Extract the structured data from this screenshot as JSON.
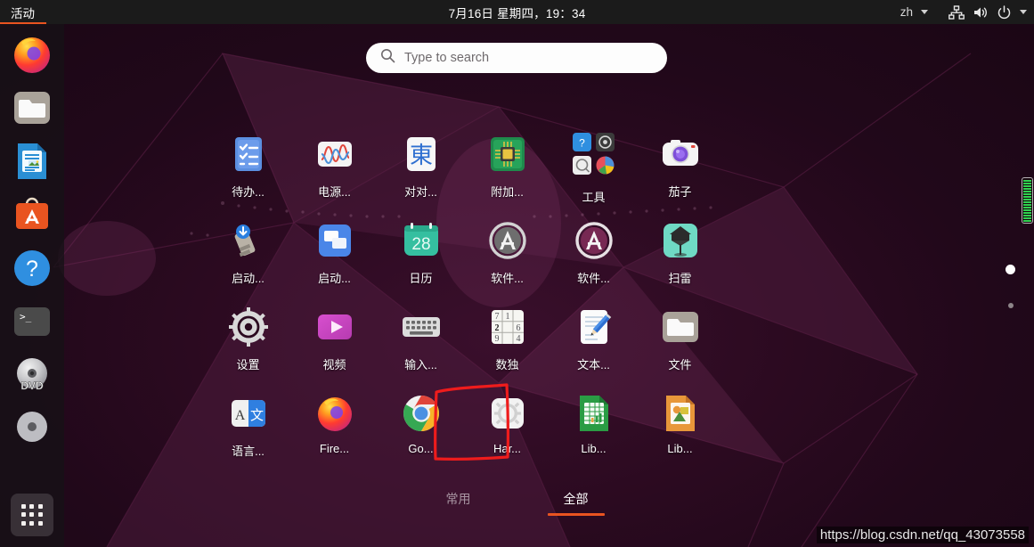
{
  "topbar": {
    "activities_label": "活动",
    "clock": "7月16日 星期四，19：34",
    "language_indicator": "zh",
    "icons": [
      "network-icon",
      "volume-icon",
      "power-icon",
      "chevron-down-icon"
    ]
  },
  "search": {
    "placeholder": "Type to search",
    "value": "",
    "icon": "search-icon"
  },
  "dock": {
    "items": [
      {
        "name": "firefox",
        "label": "Firefox"
      },
      {
        "name": "files",
        "label": "文件"
      },
      {
        "name": "libreoffice-writer",
        "label": "LibreOffice Writer"
      },
      {
        "name": "ubuntu-software",
        "label": "Ubuntu Software"
      },
      {
        "name": "help",
        "label": "帮助"
      },
      {
        "name": "terminal",
        "label": "终端"
      },
      {
        "name": "dvd-drive",
        "label": "DVD"
      },
      {
        "name": "disc-drive",
        "label": "光盘"
      }
    ],
    "show_apps_label": "显示应用程序"
  },
  "apps": [
    {
      "name": "todo",
      "label": "待办...",
      "icon": "checklist-icon"
    },
    {
      "name": "power-statistics",
      "label": "电源...",
      "icon": "power-statistics-icon"
    },
    {
      "name": "quadrapassel",
      "label": "对对...",
      "icon": "dong-character-icon"
    },
    {
      "name": "additional-drivers",
      "label": "附加...",
      "icon": "circuit-chip-icon"
    },
    {
      "name": "tools-folder",
      "label": "工具",
      "icon": "folder-group-icon",
      "folder": true,
      "children": [
        "help-icon",
        "disk-utility-icon",
        "disk-icon",
        "disk-usage-pie-icon"
      ]
    },
    {
      "name": "cheese",
      "label": "茄子",
      "icon": "camera-icon"
    },
    {
      "name": "startup-disk-creator",
      "label": "启动...",
      "icon": "usb-startup-icon"
    },
    {
      "name": "startup-applications",
      "label": "启动...",
      "icon": "windows-blue-icon"
    },
    {
      "name": "calendar",
      "label": "日历",
      "icon": "calendar-icon",
      "day": "28"
    },
    {
      "name": "software-updater",
      "label": "软件...",
      "icon": "software-a-grey-icon"
    },
    {
      "name": "software-center",
      "label": "软件...",
      "icon": "software-a-purple-icon"
    },
    {
      "name": "mines",
      "label": "扫雷",
      "icon": "mine-flag-icon"
    },
    {
      "name": "settings",
      "label": "设置",
      "icon": "gear-icon"
    },
    {
      "name": "videos",
      "label": "视频",
      "icon": "play-icon"
    },
    {
      "name": "input-method",
      "label": "输入...",
      "icon": "keyboard-icon"
    },
    {
      "name": "sudoku",
      "label": "数独",
      "icon": "sudoku-icon",
      "cells": [
        "7",
        "1",
        "",
        "2",
        "",
        "6",
        "9",
        "",
        "4"
      ]
    },
    {
      "name": "text-editor",
      "label": "文本...",
      "icon": "pencil-document-icon"
    },
    {
      "name": "nautilus",
      "label": "文件",
      "icon": "folder-icon"
    },
    {
      "name": "translator",
      "label": "语言...",
      "icon": "translate-icon",
      "glyphs": [
        "A",
        "文"
      ]
    },
    {
      "name": "firefox",
      "label": "Fire...",
      "icon": "firefox-icon"
    },
    {
      "name": "google-chrome",
      "label": "Go...",
      "icon": "chrome-icon",
      "highlighted": true
    },
    {
      "name": "hardware",
      "label": "Har...",
      "icon": "gear-light-icon"
    },
    {
      "name": "libreoffice-calc",
      "label": "Lib...",
      "icon": "calc-icon"
    },
    {
      "name": "libreoffice-impress",
      "label": "Lib...",
      "icon": "impress-icon"
    }
  ],
  "tabs": [
    {
      "name": "frequent",
      "label": "常用",
      "active": false
    },
    {
      "name": "all",
      "label": "全部",
      "active": true
    }
  ],
  "pages": {
    "active_index": 0,
    "count": 2
  },
  "annotation": {
    "type": "red-rectangle",
    "target": "google-chrome",
    "color": "#ee1c1c"
  },
  "watermark": {
    "text": "https://blog.csdn.net/qq_43073558"
  },
  "colors": {
    "accent": "#e95420",
    "topbar_bg": "#1b1b1b",
    "desktop_bg": "#2b0a20",
    "annotation_red": "#ee1c1c",
    "meter_green": "#2fd24f"
  }
}
